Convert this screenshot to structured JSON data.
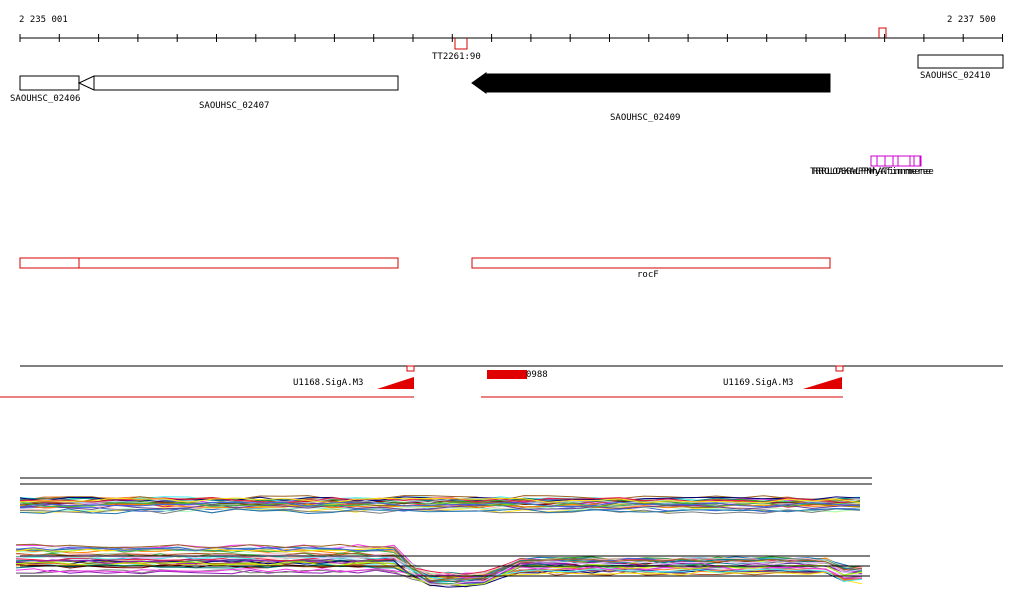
{
  "ruler": {
    "start_label": "2 235 001",
    "end_label": "2 237 500"
  },
  "colors": {
    "gene_outline": "#000000",
    "selected_gene": "#000000",
    "operon": "#d40000",
    "tfbs": "#cc00cc",
    "axis": "#000000"
  },
  "genes": [
    {
      "id": "SAOUHSC_02406",
      "label": "SAOUHSC_02406",
      "strand": "none",
      "selected": false
    },
    {
      "id": "SAOUHSC_02407",
      "label": "SAOUHSC_02407",
      "strand": "minus",
      "selected": false
    },
    {
      "id": "SAOUHSC_02409",
      "label": "SAOUHSC_02409",
      "strand": "minus",
      "selected": true
    },
    {
      "id": "SAOUHSC_02410",
      "label": "SAOUHSC_02410",
      "strand": "none",
      "selected": false
    }
  ],
  "terminator": {
    "label": "TT2261:90"
  },
  "tfbs_cluster": {
    "label": "TRRRROLLOOASKRAWLPPPNWhyAATfiinmnrmmeerneee"
  },
  "operons": {
    "rocf_label": "rocF"
  },
  "promoters": [
    {
      "label": "U1168.SigA.M3"
    },
    {
      "label": "U1169.SigA.M3"
    }
  ],
  "feature_0988": {
    "label": "0988"
  }
}
